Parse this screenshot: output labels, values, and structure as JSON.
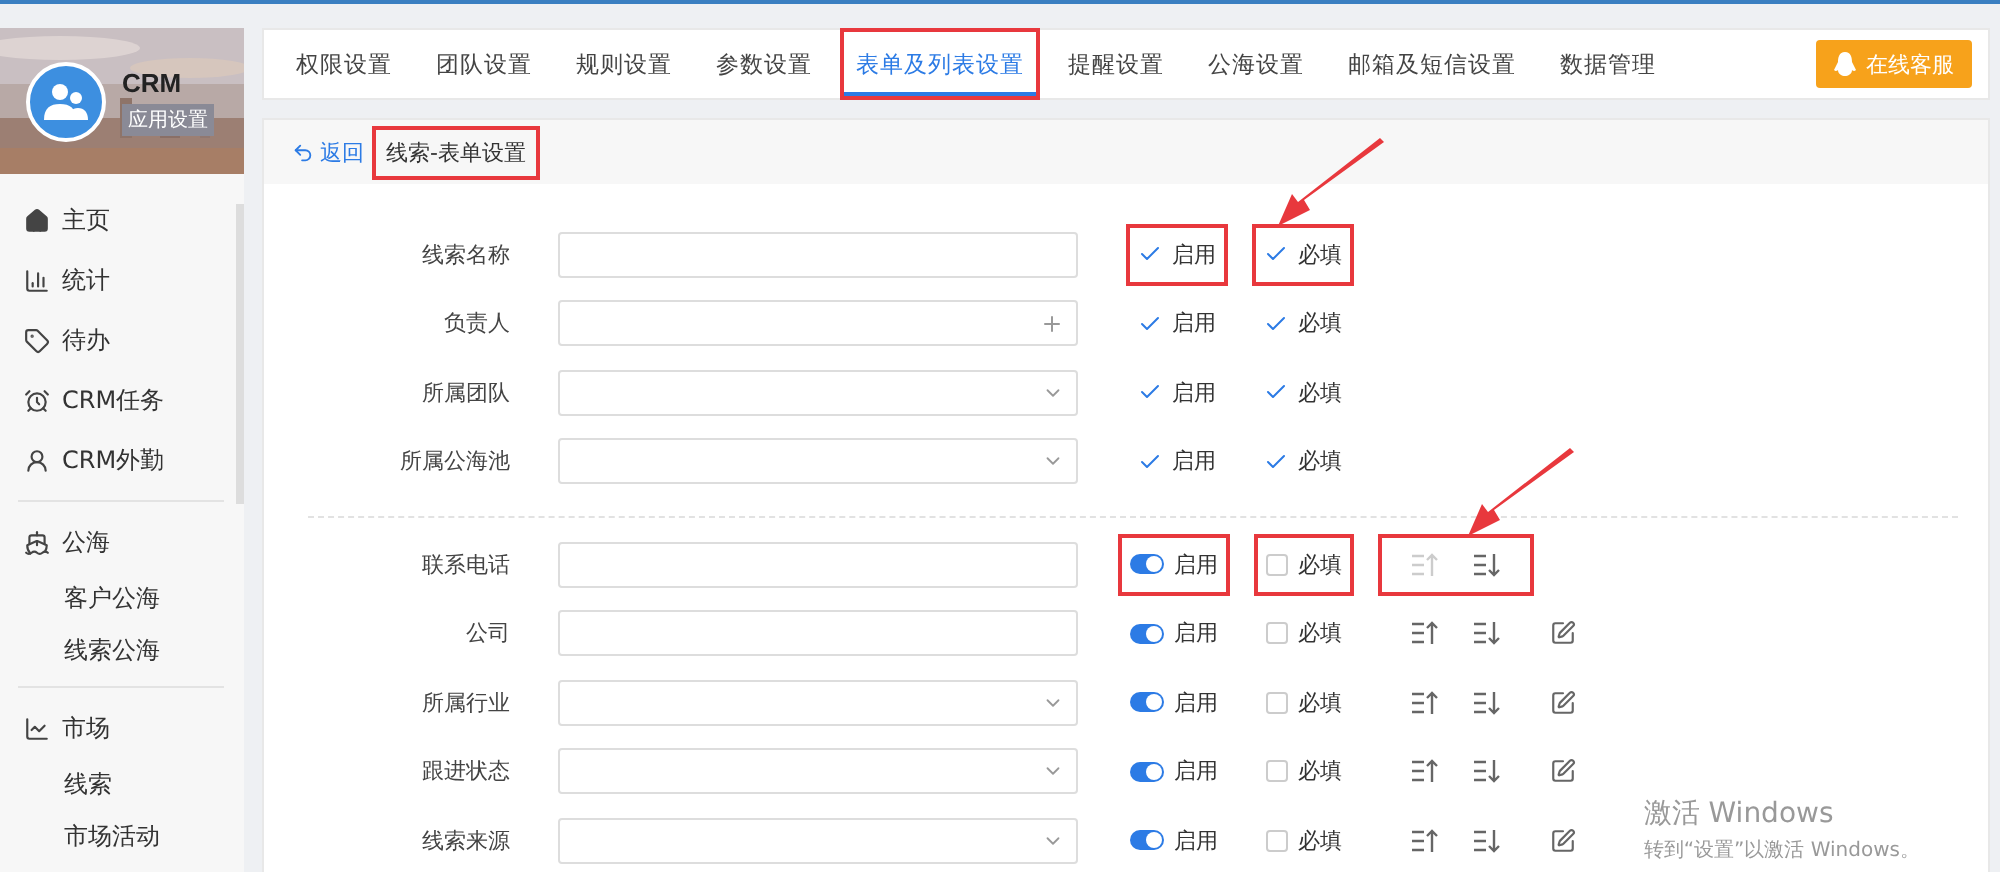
{
  "app": {
    "name": "CRM",
    "badge": "应用设置"
  },
  "sidebar": {
    "groups": [
      {
        "items": [
          {
            "label": "主页",
            "kind": "main"
          },
          {
            "label": "统计",
            "kind": "main"
          },
          {
            "label": "待办",
            "kind": "main"
          },
          {
            "label": "CRM任务",
            "kind": "main"
          },
          {
            "label": "CRM外勤",
            "kind": "main"
          }
        ]
      },
      {
        "items": [
          {
            "label": "公海",
            "kind": "main"
          },
          {
            "label": "客户公海",
            "kind": "sub"
          },
          {
            "label": "线索公海",
            "kind": "sub"
          }
        ]
      },
      {
        "items": [
          {
            "label": "市场",
            "kind": "main"
          },
          {
            "label": "线索",
            "kind": "sub"
          },
          {
            "label": "市场活动",
            "kind": "sub"
          }
        ]
      }
    ]
  },
  "tabs": [
    {
      "label": "权限设置",
      "selected": false,
      "highlighted": false
    },
    {
      "label": "团队设置",
      "selected": false,
      "highlighted": false
    },
    {
      "label": "规则设置",
      "selected": false,
      "highlighted": false
    },
    {
      "label": "参数设置",
      "selected": false,
      "highlighted": false
    },
    {
      "label": "表单及列表设置",
      "selected": true,
      "highlighted": true
    },
    {
      "label": "提醒设置",
      "selected": false,
      "highlighted": false
    },
    {
      "label": "公海设置",
      "selected": false,
      "highlighted": false
    },
    {
      "label": "邮箱及短信设置",
      "selected": false,
      "highlighted": false
    },
    {
      "label": "数据管理",
      "selected": false,
      "highlighted": false
    }
  ],
  "support_button": "在线客服",
  "breadcrumb": {
    "back": "返回",
    "title": "线索-表单设置",
    "highlighted": true
  },
  "fixed_fields": [
    {
      "label": "线索名称",
      "kind": "text",
      "enabled": true,
      "enabled_label": "启用",
      "required": true,
      "required_label": "必填",
      "highlighted": true,
      "pointer": true
    },
    {
      "label": "负责人",
      "kind": "picker",
      "enabled": true,
      "enabled_label": "启用",
      "required": true,
      "required_label": "必填",
      "highlighted": false,
      "pointer": false
    },
    {
      "label": "所属团队",
      "kind": "select",
      "enabled": true,
      "enabled_label": "启用",
      "required": true,
      "required_label": "必填",
      "highlighted": false,
      "pointer": false
    },
    {
      "label": "所属公海池",
      "kind": "select",
      "enabled": true,
      "enabled_label": "启用",
      "required": true,
      "required_label": "必填",
      "highlighted": false,
      "pointer": false
    }
  ],
  "custom_fields": [
    {
      "label": "联系电话",
      "kind": "text",
      "enabled": true,
      "enabled_label": "启用",
      "required": false,
      "required_label": "必填",
      "can_move_up": false,
      "editable": false,
      "highlighted": true,
      "pointer": true
    },
    {
      "label": "公司",
      "kind": "text",
      "enabled": true,
      "enabled_label": "启用",
      "required": false,
      "required_label": "必填",
      "can_move_up": true,
      "editable": true,
      "highlighted": false,
      "pointer": false
    },
    {
      "label": "所属行业",
      "kind": "select",
      "enabled": true,
      "enabled_label": "启用",
      "required": false,
      "required_label": "必填",
      "can_move_up": true,
      "editable": true,
      "highlighted": false,
      "pointer": false
    },
    {
      "label": "跟进状态",
      "kind": "select",
      "enabled": true,
      "enabled_label": "启用",
      "required": false,
      "required_label": "必填",
      "can_move_up": true,
      "editable": true,
      "highlighted": false,
      "pointer": false
    },
    {
      "label": "线索来源",
      "kind": "select",
      "enabled": true,
      "enabled_label": "启用",
      "required": false,
      "required_label": "必填",
      "can_move_up": true,
      "editable": true,
      "highlighted": false,
      "pointer": false
    }
  ],
  "os_notice": {
    "title": "激活 Windows",
    "text": "转到“设置”以激活 Windows。"
  }
}
